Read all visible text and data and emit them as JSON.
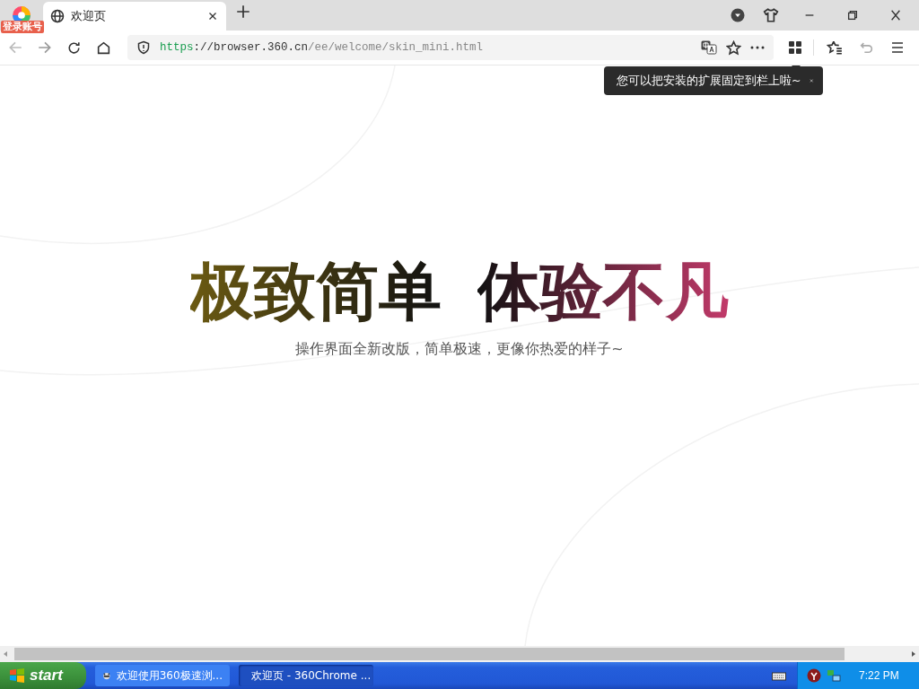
{
  "account_badge": "登录账号",
  "tabs": [
    {
      "title": "欢迎页",
      "selected": true
    }
  ],
  "address_bar": {
    "scheme": "https",
    "host": "://browser.360.cn",
    "path": "/ee/welcome/skin_mini.html"
  },
  "tooltip": {
    "text": "您可以把安装的扩展固定到栏上啦~"
  },
  "page": {
    "headline": [
      "极致简单",
      "体验不凡"
    ],
    "subtitle": "操作界面全新改版，简单极速，更像你热爱的样子~"
  },
  "taskbar": {
    "start": "start",
    "tasks": [
      {
        "title": "欢迎使用360极速浏...",
        "kind": "raccoon",
        "selected": false
      },
      {
        "title": "欢迎页 - 360Chrome ...",
        "kind": "logo",
        "selected": true
      }
    ],
    "clock": "7:22 PM"
  }
}
